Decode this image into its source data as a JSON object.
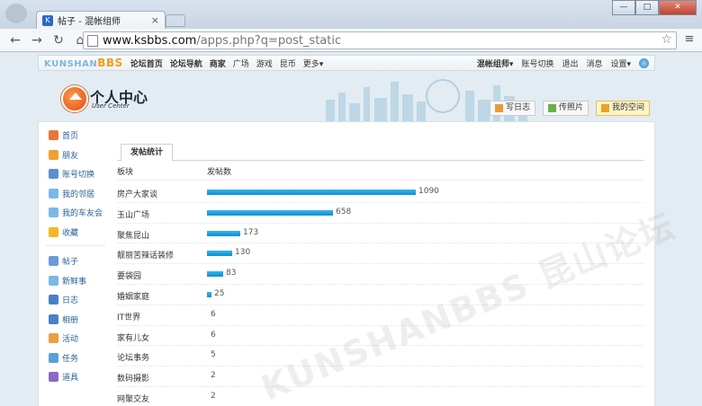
{
  "browser": {
    "tab_title": "帖子 - 混帐组师",
    "tab_favicon": "K",
    "tab_close": "×",
    "url_host": "www.ksbbs.com",
    "url_path": "/apps.php?q=post_static",
    "min": "—",
    "max": "□",
    "close": "✕"
  },
  "topnav": {
    "logo_a": "KUNSHAN",
    "logo_b": "BBS",
    "links": [
      "论坛首页",
      "论坛导航",
      "商家",
      "广场",
      "游戏",
      "昆币",
      "更多▾"
    ],
    "user": "混帐组师▾",
    "switch": "账号切换",
    "logout": "退出",
    "messages": "消息",
    "settings": "设置▾"
  },
  "banner": {
    "title": "个人中心",
    "subtitle": "User Center",
    "btn_diary": "写日志",
    "btn_photo": "传照片",
    "btn_space": "我的空间"
  },
  "sidebar": {
    "group1": [
      {
        "label": "首页",
        "icon": "home-icon",
        "color": "#e8763a"
      },
      {
        "label": "朋友",
        "icon": "friends-icon",
        "color": "#f0a030"
      },
      {
        "label": "账号切换",
        "icon": "switch-account-icon",
        "color": "#5a8fd0"
      },
      {
        "label": "我的邻居",
        "icon": "neighbor-icon",
        "color": "#7ab8e8"
      },
      {
        "label": "我的车友会",
        "icon": "car-club-icon",
        "color": "#7ab8e8"
      },
      {
        "label": "收藏",
        "icon": "star-icon",
        "color": "#f2b825"
      }
    ],
    "group2": [
      {
        "label": "帖子",
        "icon": "post-icon",
        "color": "#6a9bd8"
      },
      {
        "label": "新鲜事",
        "icon": "news-icon",
        "color": "#7ab8e8"
      },
      {
        "label": "日志",
        "icon": "diary-icon",
        "color": "#4a80c8"
      },
      {
        "label": "相册",
        "icon": "album-icon",
        "color": "#4a80c8"
      },
      {
        "label": "活动",
        "icon": "event-icon",
        "color": "#e8a040"
      },
      {
        "label": "任务",
        "icon": "task-icon",
        "color": "#5aa0d8"
      },
      {
        "label": "道具",
        "icon": "prop-icon",
        "color": "#8a6ac8"
      }
    ]
  },
  "stats": {
    "tab": "发帖统计",
    "col_board": "板块",
    "col_count": "发帖数",
    "rows": [
      {
        "name": "房产大家谈",
        "count": 1090
      },
      {
        "name": "玉山广场",
        "count": 658
      },
      {
        "name": "聚焦昆山",
        "count": 173
      },
      {
        "name": "靓丽苦辣话装修",
        "count": 130
      },
      {
        "name": "要袋园",
        "count": 83
      },
      {
        "name": "婚姻家庭",
        "count": 25
      },
      {
        "name": "IT世界",
        "count": 6
      },
      {
        "name": "家有儿女",
        "count": 6
      },
      {
        "name": "论坛事务",
        "count": 5
      },
      {
        "name": "数码摄影",
        "count": 2
      },
      {
        "name": "网聚交友",
        "count": 2
      }
    ]
  },
  "watermark": "KUNSHANBBS 昆山论坛"
}
